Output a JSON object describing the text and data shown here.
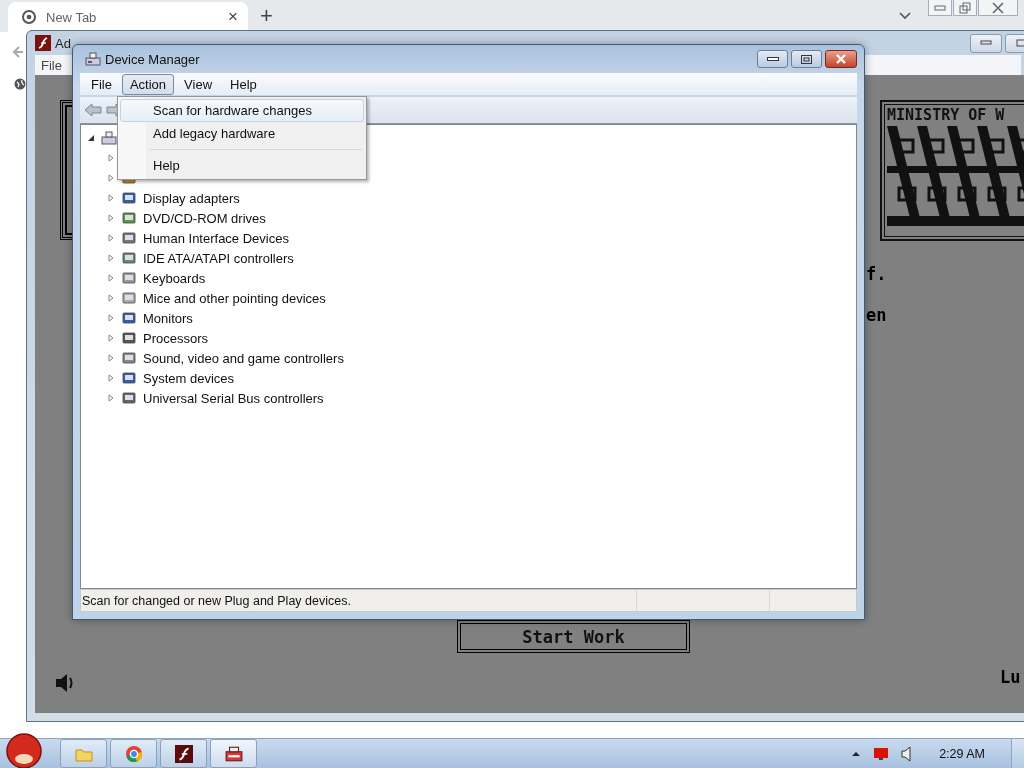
{
  "browser": {
    "tab": {
      "title": "New Tab",
      "close": "×"
    },
    "new_tab": "+"
  },
  "flash_window": {
    "title": "Ad",
    "menu": [
      "File"
    ],
    "game": {
      "poster_title": "MINISTRY OF W",
      "text_1": "f.",
      "text_2": "en",
      "start_button": "Start Work",
      "text_3": "Lu"
    }
  },
  "device_manager": {
    "title": "Device Manager",
    "menu": [
      {
        "label": "File",
        "selected": false
      },
      {
        "label": "Action",
        "selected": true
      },
      {
        "label": "View",
        "selected": false
      },
      {
        "label": "Help",
        "selected": false
      }
    ],
    "action_menu": [
      {
        "kind": "item",
        "label": "Scan for hardware changes",
        "selected": true
      },
      {
        "kind": "item",
        "label": "Add legacy hardware",
        "selected": false
      },
      {
        "kind": "separator"
      },
      {
        "kind": "item",
        "label": "Help",
        "selected": false
      }
    ],
    "tree": {
      "expanded": true,
      "children": [
        {
          "expanded": false
        },
        {
          "expanded": false
        },
        {
          "label": "Display adapters",
          "expanded": false
        },
        {
          "label": "DVD/CD-ROM drives",
          "expanded": false
        },
        {
          "label": "Human Interface Devices",
          "expanded": false
        },
        {
          "label": "IDE ATA/ATAPI controllers",
          "expanded": false
        },
        {
          "label": "Keyboards",
          "expanded": false
        },
        {
          "label": "Mice and other pointing devices",
          "expanded": false
        },
        {
          "label": "Monitors",
          "expanded": false
        },
        {
          "label": "Processors",
          "expanded": false
        },
        {
          "label": "Sound, video and game controllers",
          "expanded": false
        },
        {
          "label": "System devices",
          "expanded": false
        },
        {
          "label": "Universal Serial Bus controllers",
          "expanded": false
        }
      ]
    },
    "status_bar": {
      "text": "Scan for changed or new Plug and Play devices."
    }
  },
  "taskbar": {
    "clock": "2:29 AM"
  }
}
